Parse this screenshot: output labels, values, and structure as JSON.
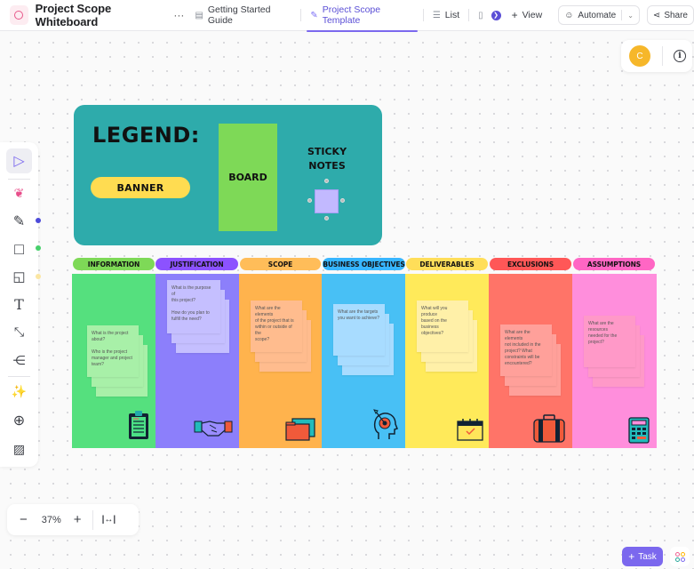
{
  "header": {
    "title": "Project Scope Whiteboard",
    "more_label": "···",
    "tabs": [
      {
        "label": "Getting Started Guide",
        "icon": "doc-icon",
        "active": false
      },
      {
        "label": "Project Scope Template",
        "icon": "whiteboard-icon",
        "active": true
      },
      {
        "label": "List",
        "icon": "list-icon",
        "active": false
      }
    ],
    "view_label": "View",
    "automate_label": "Automate",
    "share_label": "Share"
  },
  "user": {
    "avatar_initial": "C",
    "info_icon": "i"
  },
  "toolbar": {
    "tools": [
      "select",
      "ai-generate",
      "pen",
      "shape",
      "sticky-note",
      "text",
      "connector",
      "mind-map",
      "magic",
      "embed",
      "image"
    ],
    "color_dots": {
      "pen": "#4c4ad9",
      "shape": "#48d06c",
      "sticky": "#fbe6a3"
    }
  },
  "zoom": {
    "level": "37%",
    "minus": "−",
    "plus": "+",
    "fit": "|↔|"
  },
  "legend": {
    "title": "LEGEND:",
    "banner_label": "BANNER",
    "board_label": "BOARD",
    "sticky_label_1": "STICKY",
    "sticky_label_2": "NOTES"
  },
  "columns": [
    {
      "title": "INFORMATION",
      "banner_color": "#7ed957",
      "board_color": "#55e07e",
      "note_color": "#a8f0a8",
      "note_lines": [
        "What is the project",
        "about?",
        "",
        "Who is the project",
        "manager and project",
        "team?"
      ],
      "icon": "clipboard-icon"
    },
    {
      "title": "JUSTIFICATION",
      "banner_color": "#8c52ff",
      "board_color": "#8c7ffb",
      "note_color": "#c5bfff",
      "note_lines": [
        "What is the purpose of",
        "this project?",
        "",
        "How do you plan to",
        "fulfill the need?"
      ],
      "icon": "handshake-icon"
    },
    {
      "title": "SCOPE",
      "banner_color": "#ffbd59",
      "board_color": "#ffb34d",
      "note_color": "#ffbc8e",
      "note_lines": [
        "What are the elements",
        "of the project that is",
        "within or outside of the",
        "scope?"
      ],
      "icon": "folder-icon"
    },
    {
      "title": "BUSINESS OBJECTIVES",
      "banner_color": "#38b6ff",
      "board_color": "#48c0f5",
      "note_color": "#a8dcff",
      "note_lines": [
        "What are the targets",
        "you want to achieve?"
      ],
      "icon": "target-head-icon"
    },
    {
      "title": "DELIVERABLES",
      "banner_color": "#ffde59",
      "board_color": "#ffea5a",
      "note_color": "#fff0a8",
      "note_lines": [
        "What will you produce",
        "based on the business",
        "objectives?"
      ],
      "icon": "calendar-check-icon"
    },
    {
      "title": "EXCLUSIONS",
      "banner_color": "#ff5757",
      "board_color": "#ff7468",
      "note_color": "#ffa09a",
      "note_lines": [
        "What are the elements",
        "not included in the",
        "project? What",
        "constraints will be",
        "encountered?"
      ],
      "icon": "briefcase-icon"
    },
    {
      "title": "ASSUMPTIONS",
      "banner_color": "#ff66c4",
      "board_color": "#ff8edc",
      "note_color": "#ff99c8",
      "note_lines": [
        "What are the resources",
        "needed for the project?"
      ],
      "icon": "calculator-icon"
    }
  ],
  "footer": {
    "task_label": "Task"
  }
}
